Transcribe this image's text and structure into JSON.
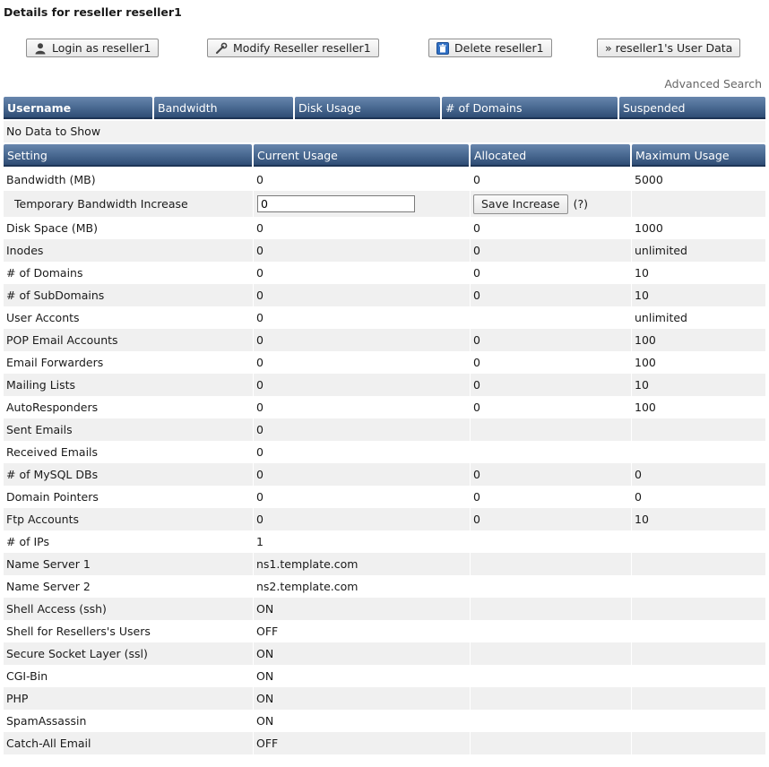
{
  "page_title": "Details for reseller reseller1",
  "actions": {
    "login": "Login as reseller1",
    "modify": "Modify Reseller reseller1",
    "delete": "Delete reseller1",
    "user_data": "» reseller1's User Data"
  },
  "advanced_search": "Advanced Search",
  "list_table": {
    "headers": [
      "Username",
      "Bandwidth",
      "Disk Usage",
      "# of Domains",
      "Suspended"
    ],
    "empty_text": "No Data to Show"
  },
  "usage_table": {
    "headers": [
      "Setting",
      "Current Usage",
      "Allocated",
      "Maximum Usage"
    ],
    "temp_bandwidth": {
      "label": "Temporary Bandwidth Increase",
      "value": "0",
      "save_label": "Save Increase",
      "help": "(?)"
    },
    "rows": [
      [
        "Bandwidth (MB)",
        "0",
        "0",
        "5000"
      ],
      [
        "Temporary Bandwidth Increase",
        "",
        "",
        ""
      ],
      [
        "Disk Space (MB)",
        "0",
        "0",
        "1000"
      ],
      [
        "Inodes",
        "0",
        "0",
        "unlimited"
      ],
      [
        "# of Domains",
        "0",
        "0",
        "10"
      ],
      [
        "# of SubDomains",
        "0",
        "0",
        "10"
      ],
      [
        "User Acconts",
        "0",
        "",
        "unlimited"
      ],
      [
        "POP Email Accounts",
        "0",
        "0",
        "100"
      ],
      [
        "Email Forwarders",
        "0",
        "0",
        "100"
      ],
      [
        "Mailing Lists",
        "0",
        "0",
        "10"
      ],
      [
        "AutoResponders",
        "0",
        "0",
        "100"
      ],
      [
        "Sent Emails",
        "0",
        "",
        ""
      ],
      [
        "Received Emails",
        "0",
        "",
        ""
      ],
      [
        "# of MySQL DBs",
        "0",
        "0",
        "0"
      ],
      [
        "Domain Pointers",
        "0",
        "0",
        "0"
      ],
      [
        "Ftp Accounts",
        "0",
        "0",
        "10"
      ],
      [
        "# of IPs",
        "1",
        "",
        ""
      ],
      [
        "Name Server 1",
        "ns1.template.com",
        "",
        ""
      ],
      [
        "Name Server 2",
        "ns2.template.com",
        "",
        ""
      ],
      [
        "Shell Access (ssh)",
        "ON",
        "",
        ""
      ],
      [
        "Shell for Resellers's Users",
        "OFF",
        "",
        ""
      ],
      [
        "Secure Socket Layer (ssl)",
        "ON",
        "",
        ""
      ],
      [
        "CGI-Bin",
        "ON",
        "",
        ""
      ],
      [
        "PHP",
        "ON",
        "",
        ""
      ],
      [
        "SpamAssassin",
        "ON",
        "",
        ""
      ],
      [
        "Catch-All Email",
        "OFF",
        "",
        ""
      ]
    ]
  }
}
